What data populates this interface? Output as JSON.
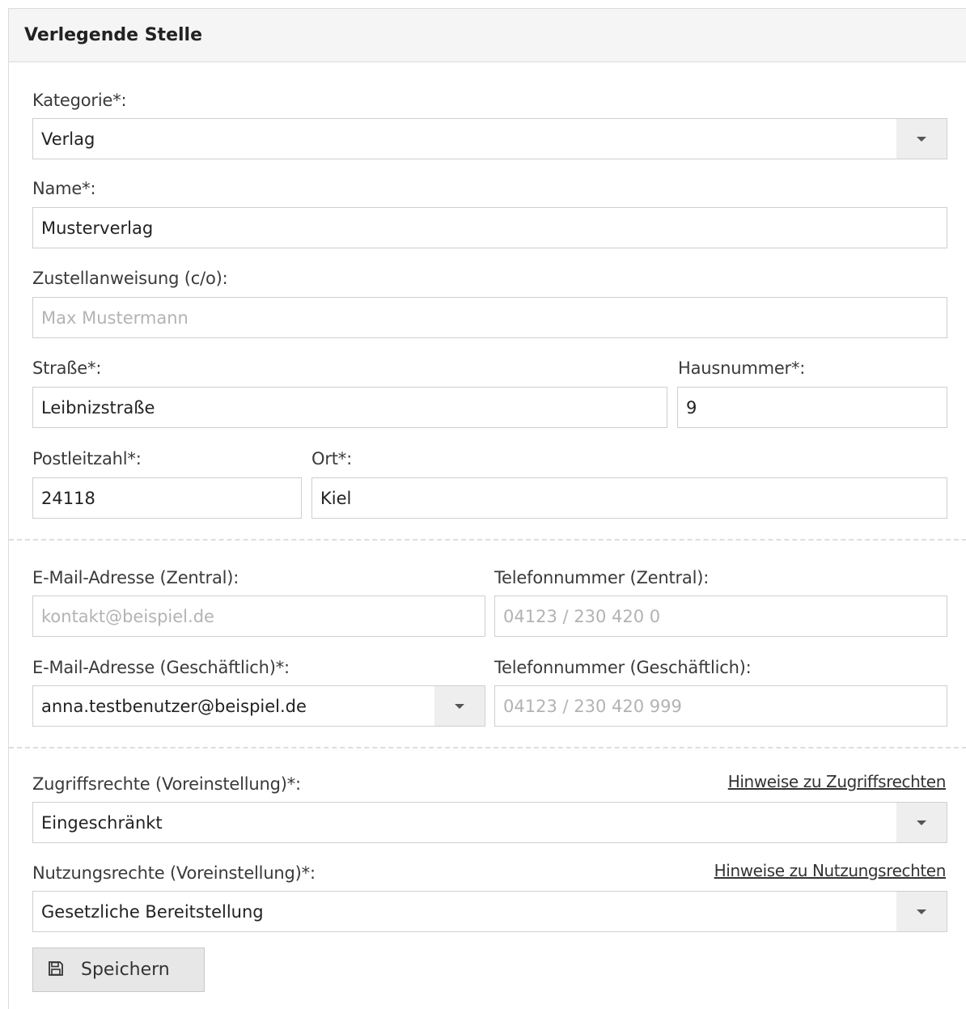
{
  "panel": {
    "title": "Verlegende Stelle"
  },
  "form": {
    "kategorie": {
      "label": "Kategorie*:",
      "value": "Verlag"
    },
    "name": {
      "label": "Name*:",
      "value": "Musterverlag"
    },
    "zustellanweisung": {
      "label": "Zustellanweisung (c/o):",
      "placeholder": "Max Mustermann"
    },
    "strasse": {
      "label": "Straße*:",
      "value": "Leibnizstraße"
    },
    "hausnummer": {
      "label": "Hausnummer*:",
      "value": "9"
    },
    "postleitzahl": {
      "label": "Postleitzahl*:",
      "value": "24118"
    },
    "ort": {
      "label": "Ort*:",
      "value": "Kiel"
    },
    "email_zentral": {
      "label": "E-Mail-Adresse (Zentral):",
      "placeholder": "kontakt@beispiel.de"
    },
    "telefon_zentral": {
      "label": "Telefonnummer (Zentral):",
      "placeholder": "04123 / 230 420 0"
    },
    "email_geschaeftlich": {
      "label": "E-Mail-Adresse (Geschäftlich)*:",
      "value": "anna.testbenutzer@beispiel.de"
    },
    "telefon_geschaeftlich": {
      "label": "Telefonnummer (Geschäftlich):",
      "placeholder": "04123 / 230 420 999"
    },
    "zugriffsrechte": {
      "label": "Zugriffsrechte (Voreinstellung)*:",
      "value": "Eingeschränkt",
      "hint_link": "Hinweise zu Zugriffsrechten"
    },
    "nutzungsrechte": {
      "label": "Nutzungsrechte (Voreinstellung)*:",
      "value": "Gesetzliche Bereitstellung",
      "hint_link": "Hinweise zu Nutzungsrechten"
    }
  },
  "actions": {
    "save_label": "Speichern",
    "save_icon": "floppy-disk-icon"
  },
  "colors": {
    "header_bg": "#f5f5f5",
    "border": "#cfcfcf",
    "button_bg": "#e7e7e7",
    "placeholder": "#b3b3b3"
  }
}
